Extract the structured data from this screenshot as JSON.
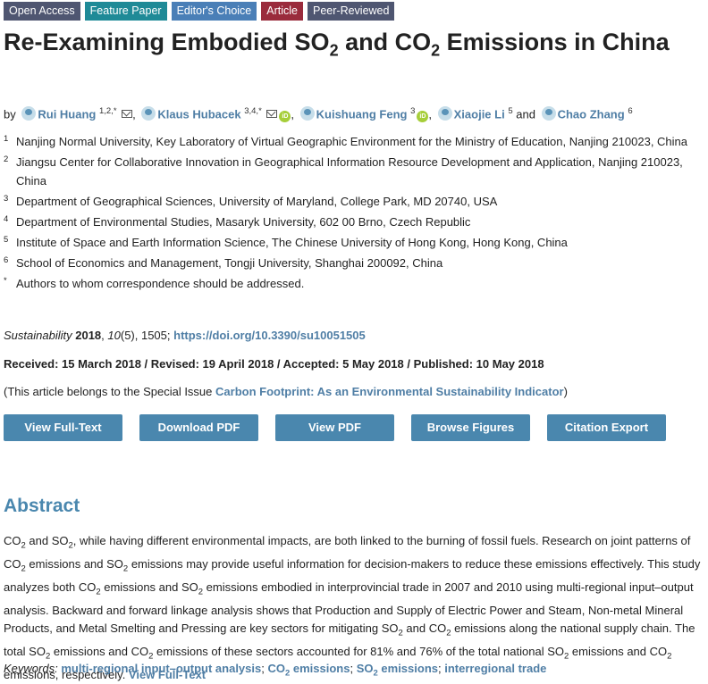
{
  "badges": [
    "Open Access",
    "Feature Paper",
    "Editor's Choice",
    "Article",
    "Peer-Reviewed"
  ],
  "title": {
    "part1": "Re-Examining Embodied SO",
    "sub1": "2",
    "part2": " and CO",
    "sub2": "2",
    "part3": " Emissions in China"
  },
  "authors": {
    "by": "by",
    "list": [
      {
        "name": "Rui Huang",
        "sup": "1,2,*"
      },
      {
        "name": "Klaus Hubacek",
        "sup": "3,4,*"
      },
      {
        "name": "Kuishuang Feng",
        "sup": "3"
      },
      {
        "name": "Xiaojie Li",
        "sup": "5"
      },
      {
        "name": "Chao Zhang",
        "sup": "6"
      }
    ],
    "and": "and",
    "orcid_label": "iD"
  },
  "affiliations": [
    {
      "num": "1",
      "text": "Nanjing Normal University, Key Laboratory of Virtual Geographic Environment for the Ministry of Education, Nanjing 210023, China"
    },
    {
      "num": "2",
      "text": "Jiangsu Center for Collaborative Innovation in Geographical Information Resource Development and Application, Nanjing 210023, China"
    },
    {
      "num": "3",
      "text": "Department of Geographical Sciences, University of Maryland, College Park, MD 20740, USA"
    },
    {
      "num": "4",
      "text": "Department of Environmental Studies, Masaryk University, 602 00 Brno, Czech Republic"
    },
    {
      "num": "5",
      "text": "Institute of Space and Earth Information Science, The Chinese University of Hong Kong, Hong Kong, China"
    },
    {
      "num": "6",
      "text": "School of Economics and Management, Tongji University, Shanghai 200092, China"
    },
    {
      "num": "*",
      "text": "Authors to whom correspondence should be addressed."
    }
  ],
  "citation": {
    "journal": "Sustainability",
    "year": "2018",
    "volume": "10",
    "issue": "(5), 1505;",
    "doi": "https://doi.org/10.3390/su10051505"
  },
  "dates": "Received: 15 March 2018 / Revised: 19 April 2018 / Accepted: 5 May 2018 / Published: 10 May 2018",
  "special_issue": {
    "prefix": "(This article belongs to the Special Issue ",
    "link": "Carbon Footprint: As an Environmental Sustainability Indicator",
    "suffix": ")"
  },
  "buttons": [
    "View Full-Text",
    "Download PDF",
    "View PDF",
    "Browse Figures",
    "Citation Export"
  ],
  "abstract": {
    "heading": "Abstract",
    "t1": "CO",
    "t2": " and SO",
    "t3": ", while having different environmental impacts, are both linked to the burning of fossil fuels. Research on joint patterns of CO",
    "t4": " emissions and SO",
    "t5": " emissions may provide useful information for decision-makers to reduce these emissions effectively. This study analyzes both CO",
    "t6": " emissions and SO",
    "t7": " emissions embodied in interprovincial trade in 2007 and 2010 using multi-regional input–output analysis. Backward and forward linkage analysis shows that Production and Supply of Electric Power and Steam, Non-metal Mineral Products, and Metal Smelting and Pressing are key sectors for mitigating SO",
    "t8": " and CO",
    "t9": " emissions along the national supply chain. The total SO",
    "t10": " emissions and CO",
    "t11": " emissions of these sectors accounted for 81% and 76% of the total national SO",
    "t12": " emissions and CO",
    "t13": " emissions, respectively. ",
    "sub": "2",
    "link": "View Full-Text"
  },
  "keywords": {
    "label": "Keywords:",
    "k1": "multi-regional input–output analysis",
    "k2a": "CO",
    "k2b": " emissions",
    "k3a": "SO",
    "k3b": " emissions",
    "k4": "interregional trade",
    "sep": "; ",
    "sub": "2"
  }
}
